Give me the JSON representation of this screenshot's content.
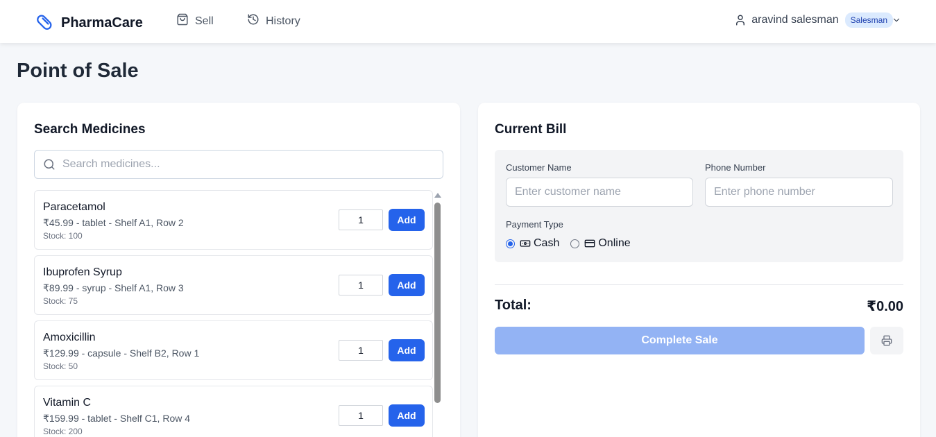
{
  "app": {
    "name": "PharmaCare",
    "brand_icon": "pill-icon",
    "accent": "#2563eb"
  },
  "nav": {
    "items": [
      {
        "label": "Sell",
        "icon": "shopping-bag-icon"
      },
      {
        "label": "History",
        "icon": "history-icon"
      }
    ]
  },
  "user": {
    "name": "aravind salesman",
    "role": "Salesman",
    "icon": "user-icon"
  },
  "page": {
    "title": "Point of Sale"
  },
  "search_panel": {
    "title": "Search Medicines",
    "search": {
      "placeholder": "Search medicines...",
      "value": ""
    },
    "add_label": "Add",
    "medicines": [
      {
        "name": "Paracetamol",
        "detail": "₹45.99 - tablet - Shelf A1, Row 2",
        "stock": "Stock: 100",
        "qty": "1"
      },
      {
        "name": "Ibuprofen Syrup",
        "detail": "₹89.99 - syrup - Shelf A1, Row 3",
        "stock": "Stock: 75",
        "qty": "1"
      },
      {
        "name": "Amoxicillin",
        "detail": "₹129.99 - capsule - Shelf B2, Row 1",
        "stock": "Stock: 50",
        "qty": "1"
      },
      {
        "name": "Vitamin C",
        "detail": "₹159.99 - tablet - Shelf C1, Row 4",
        "stock": "Stock: 200",
        "qty": "1"
      }
    ]
  },
  "bill": {
    "title": "Current Bill",
    "customer_name": {
      "label": "Customer Name",
      "placeholder": "Enter customer name",
      "value": ""
    },
    "phone": {
      "label": "Phone Number",
      "placeholder": "Enter phone number",
      "value": ""
    },
    "payment": {
      "label": "Payment Type",
      "options": [
        {
          "label": "Cash",
          "icon": "cash-icon",
          "selected": true
        },
        {
          "label": "Online",
          "icon": "credit-card-icon",
          "selected": false
        }
      ]
    },
    "total_label": "Total:",
    "total_value": "₹0.00",
    "complete_label": "Complete Sale",
    "print_icon": "printer-icon"
  }
}
